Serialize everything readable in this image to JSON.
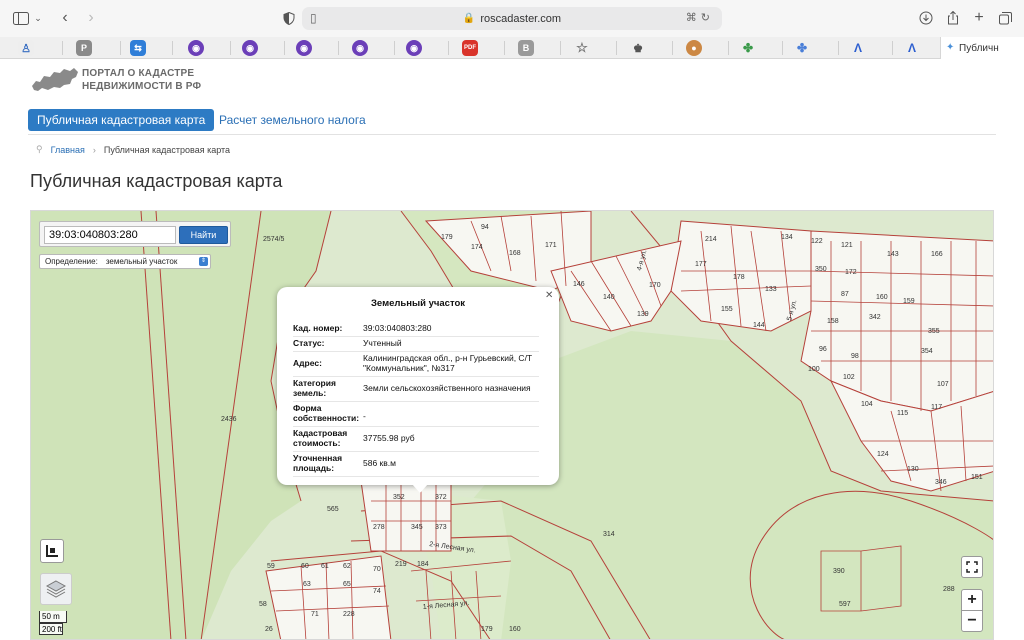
{
  "browser": {
    "url": "roscadaster.com",
    "active_tab_title": "Публичн"
  },
  "portal": {
    "logo_line1": "ПОРТАЛ О КАДАСТРЕ",
    "logo_line2": "НЕДВИЖИМОСТИ В РФ"
  },
  "nav": {
    "active": "Публичная кадастровая карта",
    "link": "Расчет земельного налога"
  },
  "breadcrumb": {
    "home": "Главная",
    "current": "Публичная кадастровая карта"
  },
  "page_title": "Публичная кадастровая карта",
  "search": {
    "value": "39:03:040803:280",
    "button": "Найти"
  },
  "definition": {
    "label": "Определение:",
    "value": "земельный участок"
  },
  "scale": {
    "metric": "50 m",
    "imperial": "200 ft"
  },
  "popup": {
    "title": "Земельный участок",
    "rows": [
      {
        "k": "Кад. номер:",
        "v": "39:03:040803:280"
      },
      {
        "k": "Статус:",
        "v": "Учтенный"
      },
      {
        "k": "Адрес:",
        "v": "Калининградская обл., р-н Гурьевский, С/Т \"Коммунальник\", №317"
      },
      {
        "k": "Категория земель:",
        "v": "Земли сельскохозяйственного назначения"
      },
      {
        "k": "Форма собственности:",
        "v": "-"
      },
      {
        "k": "Кадастровая стоимость:",
        "v": "37755.98 руб"
      },
      {
        "k": "Уточненная площадь:",
        "v": "586 кв.м"
      }
    ]
  },
  "map_labels": {
    "a2574": "2574/5",
    "a2436": "2436",
    "a314": "314",
    "a565": "565",
    "a390": "390",
    "a597": "597",
    "a288": "288",
    "a179": "179",
    "a174": "174",
    "a168": "168",
    "a171": "171",
    "a94": "94",
    "a146": "146",
    "a140": "140",
    "a139": "139",
    "a170": "170",
    "a214": "214",
    "a177": "177",
    "a178": "178",
    "a133": "133",
    "a155": "155",
    "a144": "144",
    "a134": "134",
    "a122": "122",
    "a121": "121",
    "a143": "143",
    "a166": "166",
    "a350": "350",
    "a172": "172",
    "a87": "87",
    "a158": "158",
    "a96": "96",
    "a98": "98",
    "a100": "100",
    "a102": "102",
    "a104": "104",
    "a160": "160",
    "a159": "159",
    "a342": "342",
    "a354": "354",
    "a355": "355",
    "a107": "107",
    "a115": "115",
    "a117": "117",
    "a124": "124",
    "a130": "130",
    "a346": "346",
    "a151": "151",
    "a59": "59",
    "a60": "60",
    "a61": "61",
    "a62": "62",
    "a63": "63",
    "a65": "65",
    "a58": "58",
    "a70": "70",
    "a74": "74",
    "a71": "71",
    "a228": "228",
    "a345": "345",
    "a373": "373",
    "a352": "352",
    "a372": "372",
    "a219": "219",
    "a184": "184",
    "a179b": "179",
    "a278": "278",
    "a26": "26",
    "a160b": "160",
    "street1": "1-я Лесная ул.",
    "street2": "2-я Лесная ул.",
    "street3": "4-я ул.",
    "street4": "5-я ул."
  }
}
